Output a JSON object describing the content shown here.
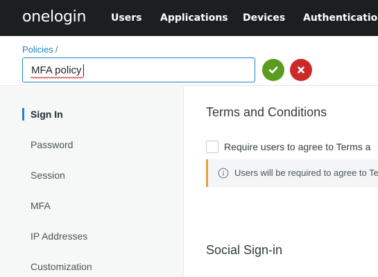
{
  "topnav": {
    "logo": "onelogin",
    "items": [
      "Users",
      "Applications",
      "Devices",
      "Authentication"
    ]
  },
  "header": {
    "breadcrumb": "Policies",
    "breadcrumb_sep": "/",
    "policy_name": "MFA policy",
    "confirm_icon": "checkmark-icon",
    "cancel_icon": "close-icon"
  },
  "sidebar": {
    "items": [
      {
        "label": "Sign In",
        "active": true
      },
      {
        "label": "Password",
        "active": false
      },
      {
        "label": "Session",
        "active": false
      },
      {
        "label": "MFA",
        "active": false
      },
      {
        "label": "IP Addresses",
        "active": false
      },
      {
        "label": "Customization",
        "active": false
      }
    ]
  },
  "main": {
    "terms_title": "Terms and Conditions",
    "terms_checkbox_label": "Require users to agree to Terms a",
    "terms_checked": false,
    "info_text": "Users will be required to agree to Te",
    "social_title": "Social Sign-in"
  },
  "colors": {
    "nav_bg": "#1c1f20",
    "accent": "#1f84c7",
    "confirm": "#5b9c1f",
    "cancel": "#cc2a27",
    "warning_bar": "#e6a23c"
  }
}
